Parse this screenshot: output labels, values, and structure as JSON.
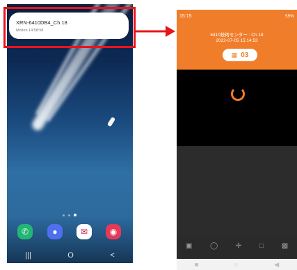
{
  "left_phone": {
    "notification": {
      "title": "XRN-6410DB4_Ch 18",
      "subtitle": "Motion 14:58:58"
    },
    "nav": {
      "recents": "|||",
      "home": "O",
      "back": "<"
    },
    "apps": [
      "phone-icon",
      "messages-icon",
      "mail-icon",
      "camera-icon"
    ]
  },
  "right_phone": {
    "status": {
      "time": "15:15",
      "right": "55%"
    },
    "title": "6410技術センター : Ch 18",
    "datetime": "2022-07-05 15:14:53",
    "channel_number": "03",
    "colors": {
      "accent": "#f07d2a"
    }
  }
}
